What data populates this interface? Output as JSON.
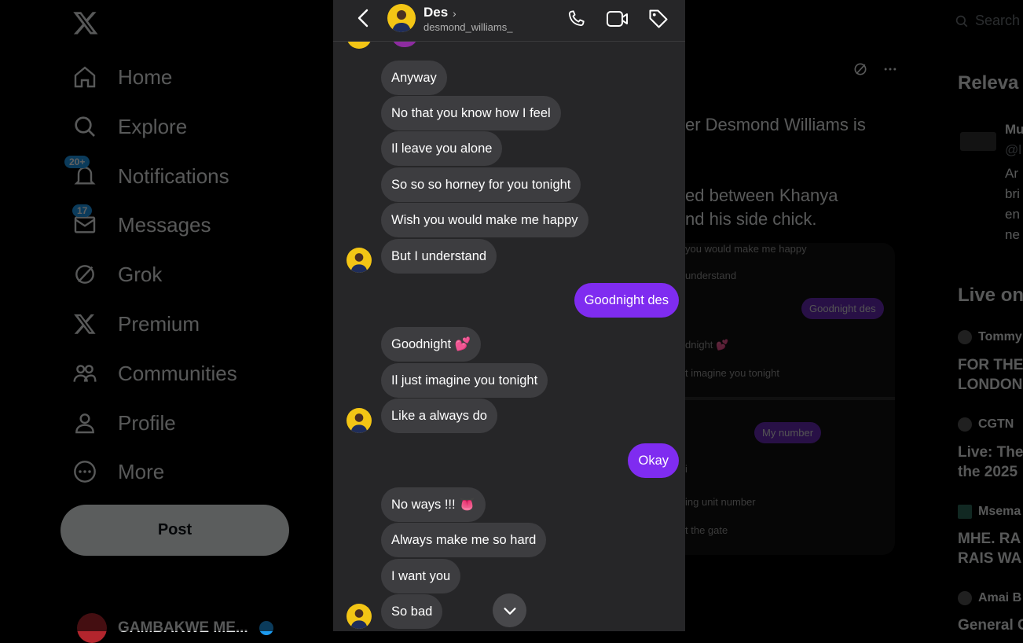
{
  "background": {
    "nav": {
      "items": [
        {
          "label": "Home",
          "icon": "home-icon"
        },
        {
          "label": "Explore",
          "icon": "search-icon"
        },
        {
          "label": "Notifications",
          "icon": "bell-icon",
          "badge": "20+"
        },
        {
          "label": "Messages",
          "icon": "mail-icon",
          "badge": "17"
        },
        {
          "label": "Grok",
          "icon": "grok-icon"
        },
        {
          "label": "Premium",
          "icon": "x-logo-icon"
        },
        {
          "label": "Communities",
          "icon": "people-icon"
        },
        {
          "label": "Profile",
          "icon": "person-icon"
        },
        {
          "label": "More",
          "icon": "more-circle-icon"
        }
      ],
      "post_label": "Post",
      "account_name": "GAMBAKWE ME..."
    },
    "post": {
      "line1": "er Desmond Williams is",
      "line2": "ed between Khanya",
      "line3": "nd his side chick.",
      "media_texts": [
        "you would make me happy",
        "understand",
        "Goodnight des",
        "dnight 💕",
        "t imagine you tonight",
        "My number",
        "i",
        "ing unit number",
        "t the gate"
      ]
    },
    "right": {
      "search_placeholder": "Search",
      "relevant_heading": "Releva",
      "relevant_user": "Mu",
      "relevant_handle": "@l",
      "relevant_bio": [
        "Ar",
        "bri",
        "en",
        "ne"
      ],
      "live_heading": "Live on",
      "live_items": [
        {
          "source": "Tommy",
          "title": [
            "FOR THE",
            "LONDON"
          ]
        },
        {
          "source": "CGTN",
          "title": [
            "Live: The",
            "the 2025"
          ]
        },
        {
          "source": "Msema",
          "title": [
            "MHE. RA",
            "RAIS WA"
          ]
        },
        {
          "source": "Amai B",
          "title": [
            "General C"
          ]
        }
      ]
    }
  },
  "dm": {
    "contact_name": "Des",
    "contact_handle": "desmond_williams_",
    "messages": [
      {
        "dir": "in",
        "text": "Anyway"
      },
      {
        "dir": "in",
        "text": "No that you know how I feel"
      },
      {
        "dir": "in",
        "text": "Il leave you alone"
      },
      {
        "dir": "in",
        "text": "So so so horney for you tonight"
      },
      {
        "dir": "in",
        "text": "Wish you would make me happy"
      },
      {
        "dir": "in",
        "text": "But I understand"
      },
      {
        "dir": "out",
        "text": "Goodnight des"
      },
      {
        "dir": "in",
        "text": "Goodnight 💕"
      },
      {
        "dir": "in",
        "text": "Il just imagine you tonight"
      },
      {
        "dir": "in",
        "text": "Like a always do"
      },
      {
        "dir": "out",
        "text": "Okay"
      },
      {
        "dir": "in",
        "text": "No ways !!! 👅"
      },
      {
        "dir": "in",
        "text": "Always make me so hard"
      },
      {
        "dir": "in",
        "text": "I want you"
      },
      {
        "dir": "in",
        "text": "So bad"
      }
    ]
  },
  "colors": {
    "outgoing_bubble": "#7f2cf0",
    "incoming_bubble": "#3d3d40",
    "dm_bg": "#262628",
    "accent": "#1d9bf0"
  }
}
